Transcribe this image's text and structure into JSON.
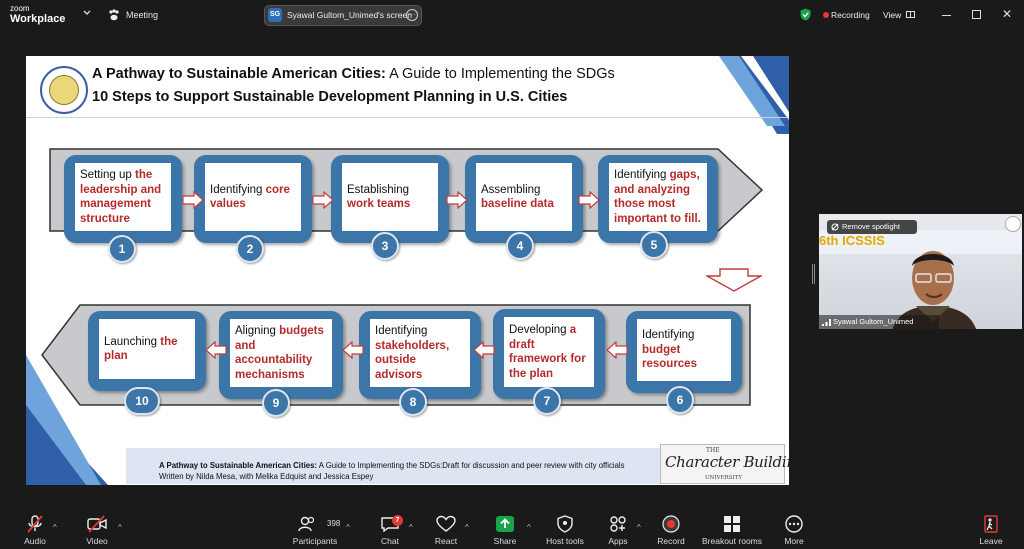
{
  "app": {
    "logo_top": "zoom",
    "logo_bottom": "Workplace",
    "meeting_label": "Meeting",
    "share_badge": "SG",
    "share_label": "Syawal Gultom_Unimed's screen",
    "recording_label": "Recording",
    "view_label": "View"
  },
  "slide": {
    "title_bold": "A Pathway to Sustainable American Cities:",
    "title_rest": " A Guide to Implementing the SDGs",
    "subtitle": "10 Steps to Support Sustainable Development Planning in U.S. Cities",
    "steps": [
      {
        "num": "1",
        "plain": "Setting up ",
        "red": "the leadership and management structure",
        "tail": ""
      },
      {
        "num": "2",
        "plain": "Identifying ",
        "red": "core values",
        "tail": ""
      },
      {
        "num": "3",
        "plain": "Establishing ",
        "red": "work teams",
        "tail": ""
      },
      {
        "num": "4",
        "plain": "Assembling ",
        "red": "baseline data",
        "tail": ""
      },
      {
        "num": "5",
        "plain": "Identifying ",
        "red": "gaps, and analyzing those most important to fill.",
        "tail": ""
      },
      {
        "num": "6",
        "plain": "Identifying ",
        "red": "budget resources",
        "tail": ""
      },
      {
        "num": "7",
        "plain": "Developing ",
        "red": "a draft framework for the plan",
        "tail": ""
      },
      {
        "num": "8",
        "plain": "Identifying ",
        "red": "stakeholders, outside advisors",
        "tail": ""
      },
      {
        "num": "9",
        "plain": "Aligning ",
        "red": "budgets and accountability mechanisms",
        "tail": ""
      },
      {
        "num": "10",
        "plain": "Launching ",
        "red": "the plan",
        "tail": ""
      }
    ],
    "footer_bold": "A Pathway to Sustainable American Cities:",
    "footer_rest": " A Guide to Implementing the SDGs:Draft for discussion and peer review with city officials",
    "footer_authors": "Written by Nilda Mesa, with Melika Edquist and Jessica Espey",
    "logo_the": "THE",
    "logo_name": "Character Building",
    "logo_university": "UNIVERSITY"
  },
  "video": {
    "banner": "6th ICSSIS",
    "remove_spotlight": "Remove spotlight",
    "participant_name": "Syawal Gultom_Unimed"
  },
  "toolbar": {
    "audio": "Audio",
    "video": "Video",
    "participants": "Participants",
    "participants_count": "398",
    "chat": "Chat",
    "chat_badge": "7",
    "react": "React",
    "share": "Share",
    "host_tools": "Host tools",
    "apps": "Apps",
    "record": "Record",
    "breakout": "Breakout rooms",
    "more": "More",
    "leave": "Leave"
  },
  "colors": {
    "step_blue": "#3c75a8",
    "accent_red": "#b52b2b",
    "share_green": "#1aa34a",
    "record_red": "#e53935"
  }
}
